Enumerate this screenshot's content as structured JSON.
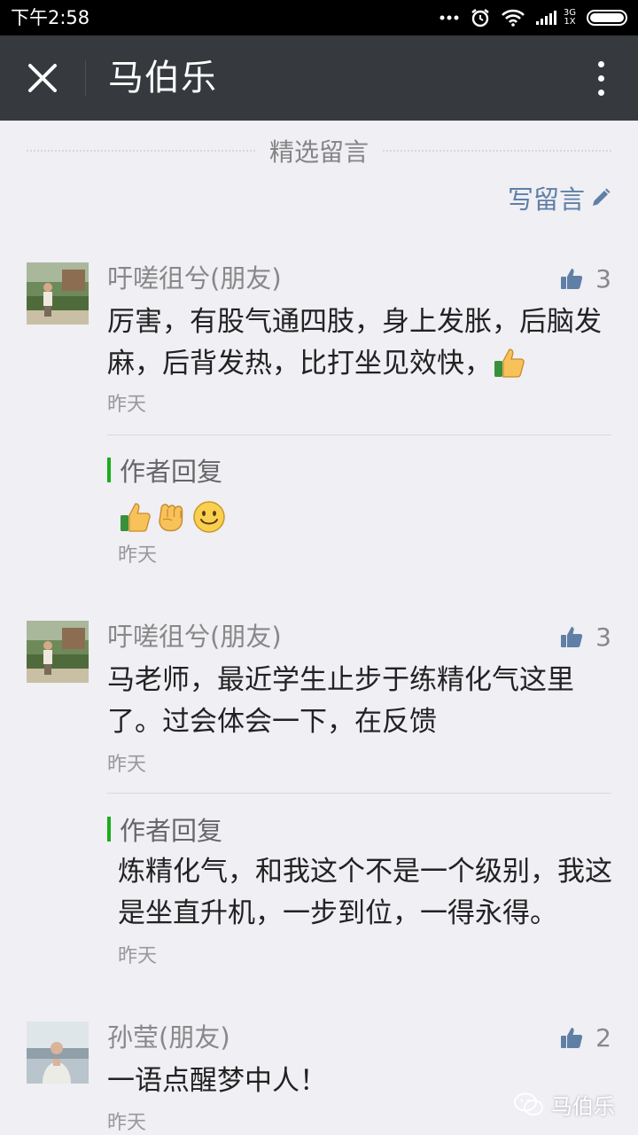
{
  "status_bar": {
    "time": "下午2:58",
    "network_top": "3G",
    "network_bottom": "1X"
  },
  "header": {
    "title": "马伯乐"
  },
  "section": {
    "title": "精选留言",
    "write_label": "写留言"
  },
  "comments": [
    {
      "nickname": "吁嗟徂兮(朋友)",
      "likes": "3",
      "text": "厉害，有股气通四肢，身上发胀，后脑发麻，后背发热，比打坐见效快，",
      "time": "昨天",
      "reply_label": "作者回复",
      "reply_text": "",
      "reply_emojis": [
        "thumbs-up",
        "fist",
        "smile"
      ],
      "reply_time": "昨天"
    },
    {
      "nickname": "吁嗟徂兮(朋友)",
      "likes": "3",
      "text": "马老师，最近学生止步于练精化气这里了。过会体会一下，在反馈",
      "time": "昨天",
      "reply_label": "作者回复",
      "reply_text": "炼精化气，和我这个不是一个级别，我这是坐直升机，一步到位，一得永得。",
      "reply_time": "昨天"
    },
    {
      "nickname": "孙莹(朋友)",
      "likes": "2",
      "text": "一语点醒梦中人！",
      "time": "昨天"
    }
  ],
  "watermark": {
    "text": "马伯乐"
  },
  "colors": {
    "titlebar": "#363a3e",
    "link_blue": "#607fa6",
    "reply_bar_green": "#1aad19",
    "background": "#efeff4"
  }
}
